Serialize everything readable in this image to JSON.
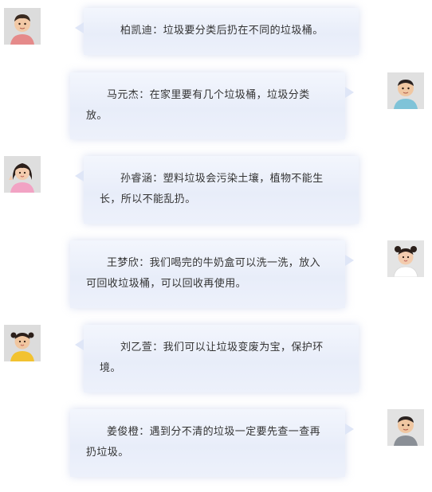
{
  "messages": [
    {
      "side": "left",
      "avatar": "child-avatar-1",
      "text": "柏凯迪：垃圾要分类后扔在不同的垃圾桶。"
    },
    {
      "side": "right",
      "avatar": "child-avatar-2",
      "text": "马元杰：在家里要有几个垃圾桶，垃圾分类放。"
    },
    {
      "side": "left",
      "avatar": "child-avatar-3",
      "text": "孙睿涵：塑料垃圾会污染土壤，植物不能生长，所以不能乱扔。"
    },
    {
      "side": "right",
      "avatar": "child-avatar-4",
      "text": "王梦欣：我们喝完的牛奶盒可以洗一洗，放入可回收垃圾桶，可以回收再使用。"
    },
    {
      "side": "left",
      "avatar": "child-avatar-5",
      "text": "刘乙萱：我们可以让垃圾变废为宝，保护环境。"
    },
    {
      "side": "right",
      "avatar": "child-avatar-6",
      "text": "姜俊橙：遇到分不清的垃圾一定要先查一查再扔垃圾。"
    }
  ],
  "colors": {
    "bubble_top": "#f3f6fd",
    "bubble_bottom": "#e8edf9",
    "text": "#333333",
    "page_bg": "#ffffff"
  }
}
